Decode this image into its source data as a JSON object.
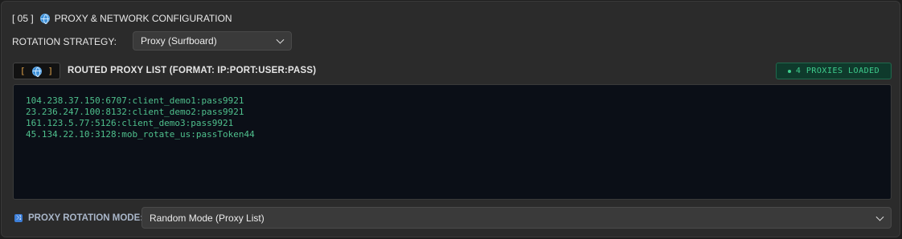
{
  "section": {
    "number": "[ 05 ]",
    "icon": "globe-icon",
    "title": "PROXY & NETWORK CONFIGURATION"
  },
  "rotation_strategy": {
    "label": "ROTATION STRATEGY:",
    "selected": "Proxy (Surfboard)"
  },
  "proxy_list": {
    "icon_badge_left": "[",
    "icon_badge_right": "]",
    "title": "ROUTED PROXY LIST (FORMAT: IP:PORT:USER:PASS)",
    "loaded_badge": "4 PROXIES LOADED",
    "lines": [
      "104.238.37.150:6707:client_demo1:pass9921",
      "23.236.247.100:8132:client_demo2:pass9921",
      "161.123.5.77:5126:client_demo3:pass9921",
      "45.134.22.10:3128:mob_rotate_us:passToken44"
    ]
  },
  "rotation_mode": {
    "icon": "shuffle-icon",
    "label": "PROXY ROTATION MODE:",
    "selected": "Random Mode (Proxy List)"
  },
  "colors": {
    "accent_green": "#3fcf8e",
    "accent_orange": "#e0a24a",
    "accent_blue": "#3d8fd6"
  }
}
